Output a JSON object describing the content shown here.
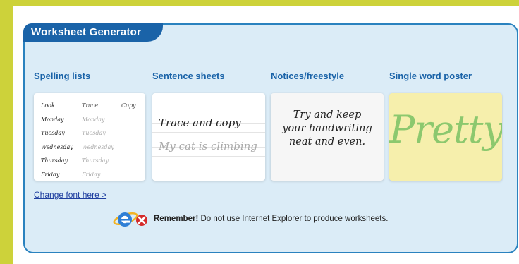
{
  "panel": {
    "title": "Worksheet Generator"
  },
  "columns": [
    {
      "heading": "Spelling lists"
    },
    {
      "heading": "Sentence sheets"
    },
    {
      "heading": "Notices/freestyle"
    },
    {
      "heading": "Single word poster"
    }
  ],
  "spelling": {
    "header": [
      "Look",
      "Trace",
      "Copy"
    ],
    "rows": [
      [
        "Monday",
        "Monday"
      ],
      [
        "Tuesday",
        "Tuesday"
      ],
      [
        "Wednesday",
        "Wednesday"
      ],
      [
        "Thursday",
        "Thursday"
      ],
      [
        "Friday",
        "Friday"
      ]
    ]
  },
  "sentence": {
    "main": "Trace and copy",
    "sub": "My cat is climbing"
  },
  "notices": {
    "lines": [
      "Try and keep",
      "your handwriting",
      "neat and even."
    ]
  },
  "poster": {
    "word": "Pretty"
  },
  "change_font": "Change font here >",
  "notice": {
    "icon": "internet-explorer-blocked-icon",
    "bold": "Remember!",
    "text": " Do not use Internet Explorer to produce worksheets."
  },
  "colors": {
    "background": "#cdd23a",
    "accent": "#1a63a8",
    "panel": "#dbecf7",
    "poster_bg": "#f6efac",
    "poster_text": "#8cc86e"
  }
}
